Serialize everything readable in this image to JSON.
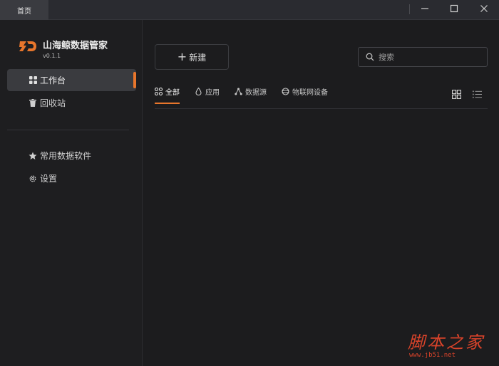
{
  "titlebar": {
    "tab_label": "首页",
    "controls": [
      "minimize-icon",
      "maximize-icon",
      "close-icon"
    ]
  },
  "sidebar": {
    "app_name": "山海鲸数据管家",
    "version": "v0.1.1",
    "items": [
      {
        "label": "工作台",
        "icon": "grid-icon",
        "active": true
      },
      {
        "label": "回收站",
        "icon": "trash-icon",
        "active": false
      }
    ],
    "items2": [
      {
        "label": "常用数据软件",
        "icon": "star-icon"
      },
      {
        "label": "设置",
        "icon": "gear-icon"
      }
    ]
  },
  "main": {
    "new_label": "新建",
    "search_placeholder": "搜索",
    "tabs": [
      {
        "label": "全部",
        "icon": "apps-icon",
        "active": true
      },
      {
        "label": "应用",
        "icon": "drop-icon"
      },
      {
        "label": "数据源",
        "icon": "nodes-icon"
      },
      {
        "label": "物联网设备",
        "icon": "device-icon"
      }
    ]
  },
  "watermark": {
    "text": "脚本之家",
    "url": "www.jb51.net"
  },
  "colors": {
    "accent": "#e8762c",
    "background": "#1c1c1e",
    "sidebar_active": "#3a3b3f"
  }
}
